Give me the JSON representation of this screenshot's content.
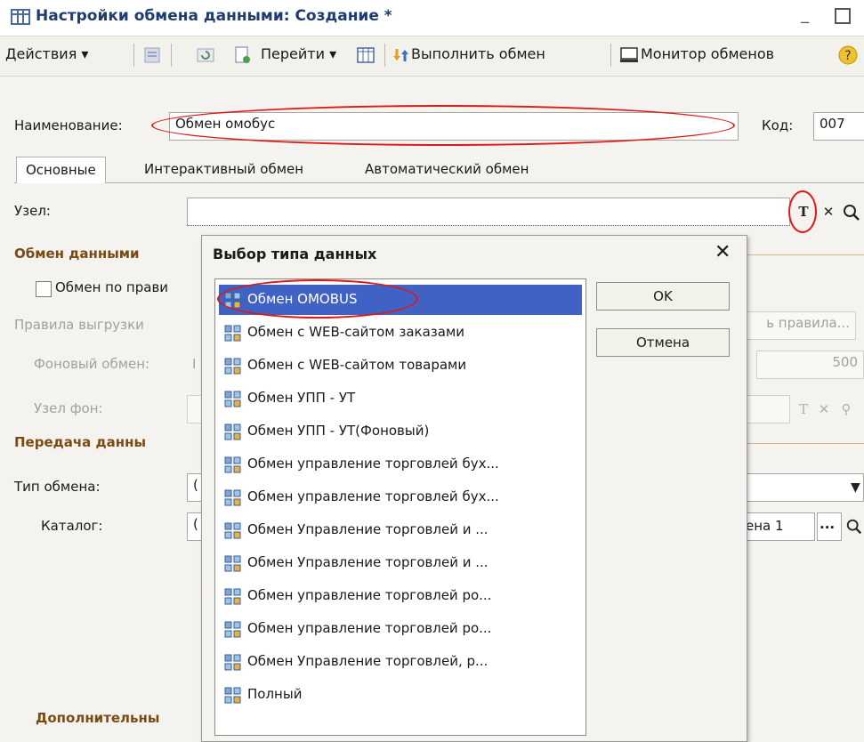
{
  "window": {
    "title": "Настройки обмена данными: Создание *"
  },
  "toolbar": {
    "actions": "Действия",
    "goto": "Перейти",
    "run_exchange": "Выполнить обмен",
    "monitor": "Монитор обменов"
  },
  "form": {
    "name_label": "Наименование:",
    "name_value": "Обмен омобус",
    "code_label": "Код:",
    "code_value": "007",
    "tabs": [
      "Основные",
      "Интерактивный обмен",
      "Автоматический обмен"
    ],
    "node_label": "Узел:",
    "section_exchange": "Обмен данными",
    "rules_checkbox": "Обмен по прави",
    "upload_rules": "Правила выгрузки",
    "rules_button": "ь правила...",
    "bg_exchange": "Фоновый обмен:",
    "bg_value_fragment": "I",
    "bg_number": "500",
    "node_bg": "Узел фон:",
    "section_transfer": "Передача данны",
    "exchange_type": "Тип обмена:",
    "type_value_fragment": "(",
    "catalog": "Каталог:",
    "catalog_value_fragment": "(",
    "catalog_right": "ена 1",
    "section_extra": "Дополнительны",
    "ellipsis_button": "..."
  },
  "dialog": {
    "title": "Выбор типа данных",
    "close": "✕",
    "ok": "OK",
    "cancel": "Отмена",
    "items": [
      "Обмен OMOBUS",
      "Обмен с WEB-сайтом заказами",
      "Обмен с WEB-сайтом товарами",
      "Обмен УПП - УТ",
      "Обмен УПП - УТ(Фоновый)",
      "Обмен управление торговлей бух...",
      "Обмен управление торговлей бух...",
      "Обмен Управление торговлей и ...",
      "Обмен Управление торговлей и ...",
      "Обмен управление торговлей ро...",
      "Обмен управление торговлей ро...",
      "Обмен Управление торговлей, р...",
      "Полный"
    ]
  },
  "colors": {
    "selection": "#3f62c4",
    "annotation": "#e01818",
    "section": "#7b4a14"
  }
}
